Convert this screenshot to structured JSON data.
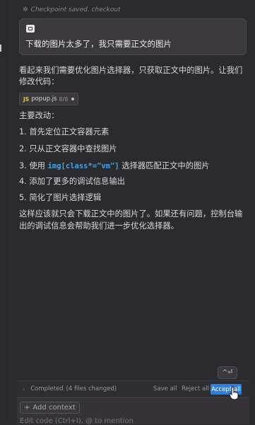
{
  "checkpoint": {
    "icon": "star-icon",
    "text": "Checkpoint saved. checkout"
  },
  "user_message": {
    "icon": "image-icon",
    "text": "下载的图片太多了，我只需要正文的图片"
  },
  "response": {
    "intro": "看起来我们需要优化图片选择器，只获取正文中的图片。让我们修改代码：",
    "file_chip": {
      "lang": "JS",
      "name": "popup.js",
      "count": "8/8"
    },
    "heading": "主要改动：",
    "items": [
      {
        "num": "1.",
        "text": "首先定位正文容器元素"
      },
      {
        "num": "2.",
        "text": "只从正文容器中查找图片"
      },
      {
        "num": "3.",
        "pre": "使用",
        "code": "img[class*=\"vm\"]",
        "post": "选择器匹配正文中的图片"
      },
      {
        "num": "4.",
        "text": "添加了更多的调试信息输出"
      },
      {
        "num": "5.",
        "text": "简化了图片选择逻辑"
      }
    ],
    "summary": "这样应该就只会下载正文中的图片了。如果还有问题，控制台输出的调试信息会帮助我们进一步优化选择器。"
  },
  "toolbar": {
    "kbd_label": "^⏎",
    "status": "Completed",
    "files_changed": "(4 files changed)",
    "save_all": "Save all",
    "reject_all": "Reject all",
    "accept_all": "Accept all"
  },
  "composer": {
    "add_context": "Add context",
    "placeholder": "Edit code (Ctrl+I), @ to mention"
  },
  "colors": {
    "accent": "#2f7fd6",
    "code": "#3ea6f0",
    "background": "#2b2a2d"
  }
}
